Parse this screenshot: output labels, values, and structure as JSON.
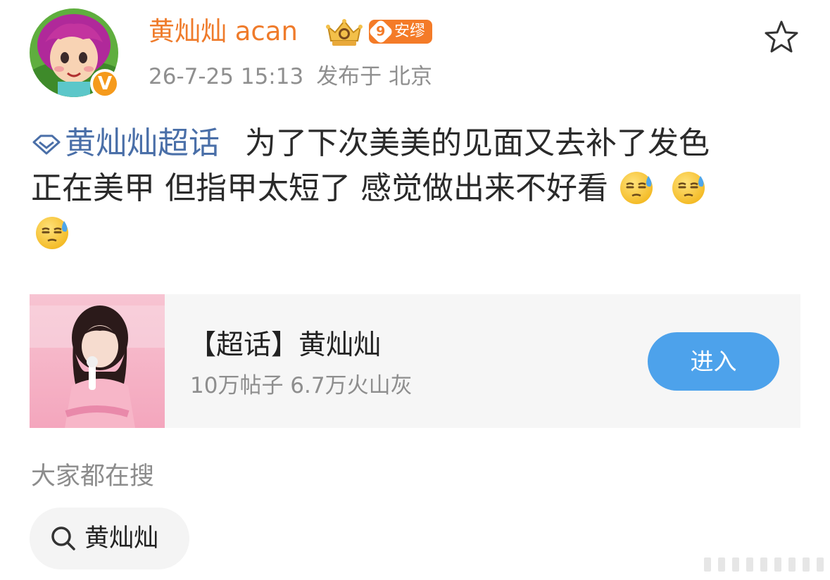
{
  "colors": {
    "username": "#ef7b2b",
    "topic_link": "#4a6fa8",
    "enter_button": "#4da2eb",
    "meta_text": "#8f8f8f",
    "level_badge": "#f47b28"
  },
  "user": {
    "name": "黄灿灿 acan",
    "level": "9",
    "badge_label": "安缪",
    "verified_icon": "v-verified-icon",
    "avatar_icon": "avatar-image"
  },
  "meta": {
    "timestamp": "26-7-25 15:13",
    "location": "发布于 北京"
  },
  "post": {
    "topic": "黄灿灿超话",
    "text_line1": "为了下次美美的见面又去补了发色",
    "text_line2": "正在美甲 但指甲太短了 感觉做出来不好看",
    "emoji_name": "sweat-face-icon"
  },
  "card": {
    "title": "【超话】黄灿灿",
    "stats": "10万帖子 6.7万火山灰",
    "button_label": "进入"
  },
  "search": {
    "heading": "大家都在搜",
    "query": "黄灿灿"
  }
}
